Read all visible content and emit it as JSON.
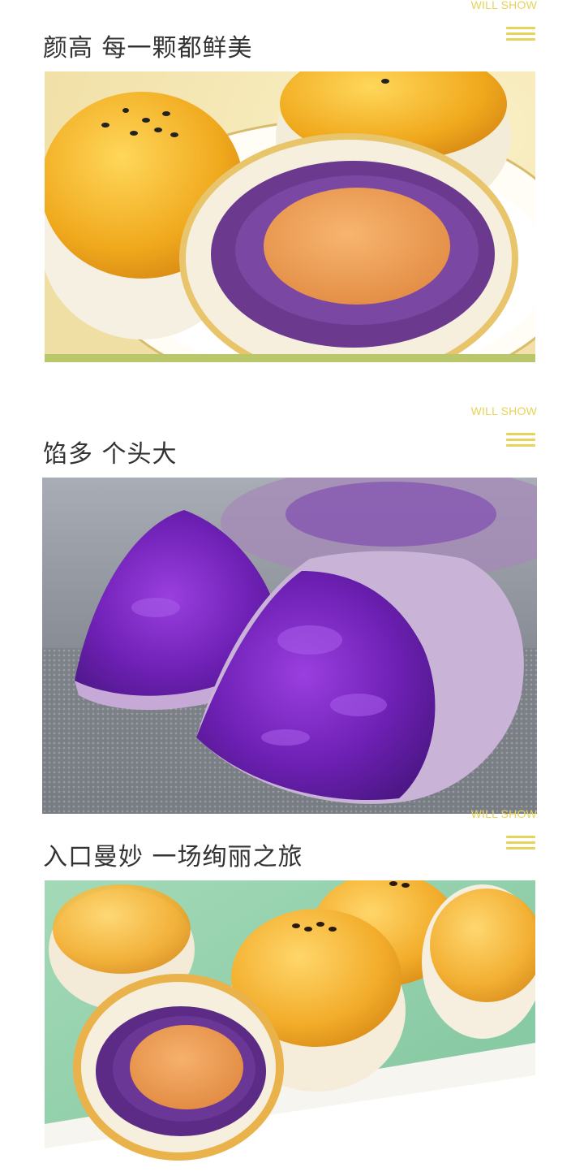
{
  "colors": {
    "accent": "#e6d45a",
    "title_text": "#333333"
  },
  "sections": [
    {
      "tagline": "WILL SHOW",
      "title": "颜高 每一颗都鲜美",
      "menu_icon": "hamburger-menu-icon",
      "photo": "purple-sweet-potato-egg-yolk-pastries-on-plate"
    },
    {
      "tagline": "WILL SHOW",
      "title": "馅多 个头大",
      "menu_icon": "hamburger-menu-icon",
      "photo": "broken-purple-sweet-potato-closeup"
    },
    {
      "tagline": "WILL SHOW",
      "title": "入口曼妙 一场绚丽之旅",
      "menu_icon": "hamburger-menu-icon",
      "photo": "egg-yolk-pastries-on-green-background"
    }
  ]
}
